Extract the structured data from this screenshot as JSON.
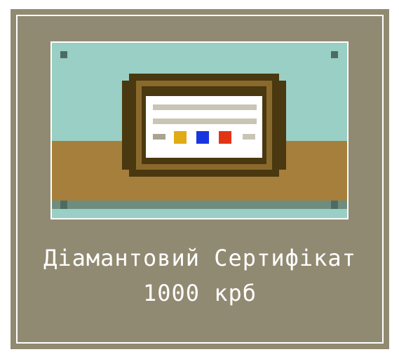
{
  "item": {
    "name": "Діамантовий Сертифікат",
    "price": "1000 крб",
    "icon": "framed-certificate-icon"
  },
  "colors": {
    "card_background": "#918a72",
    "wall": "#99cfc4",
    "floor": "#a67f3c",
    "frame_dark": "#4a3810",
    "frame_mid": "#8a6a2c",
    "paper": "#ffffff",
    "stripe": "#c9c4b4",
    "swatch_yellow": "#e0ab14",
    "swatch_blue": "#1836e0",
    "swatch_red": "#e23516"
  }
}
